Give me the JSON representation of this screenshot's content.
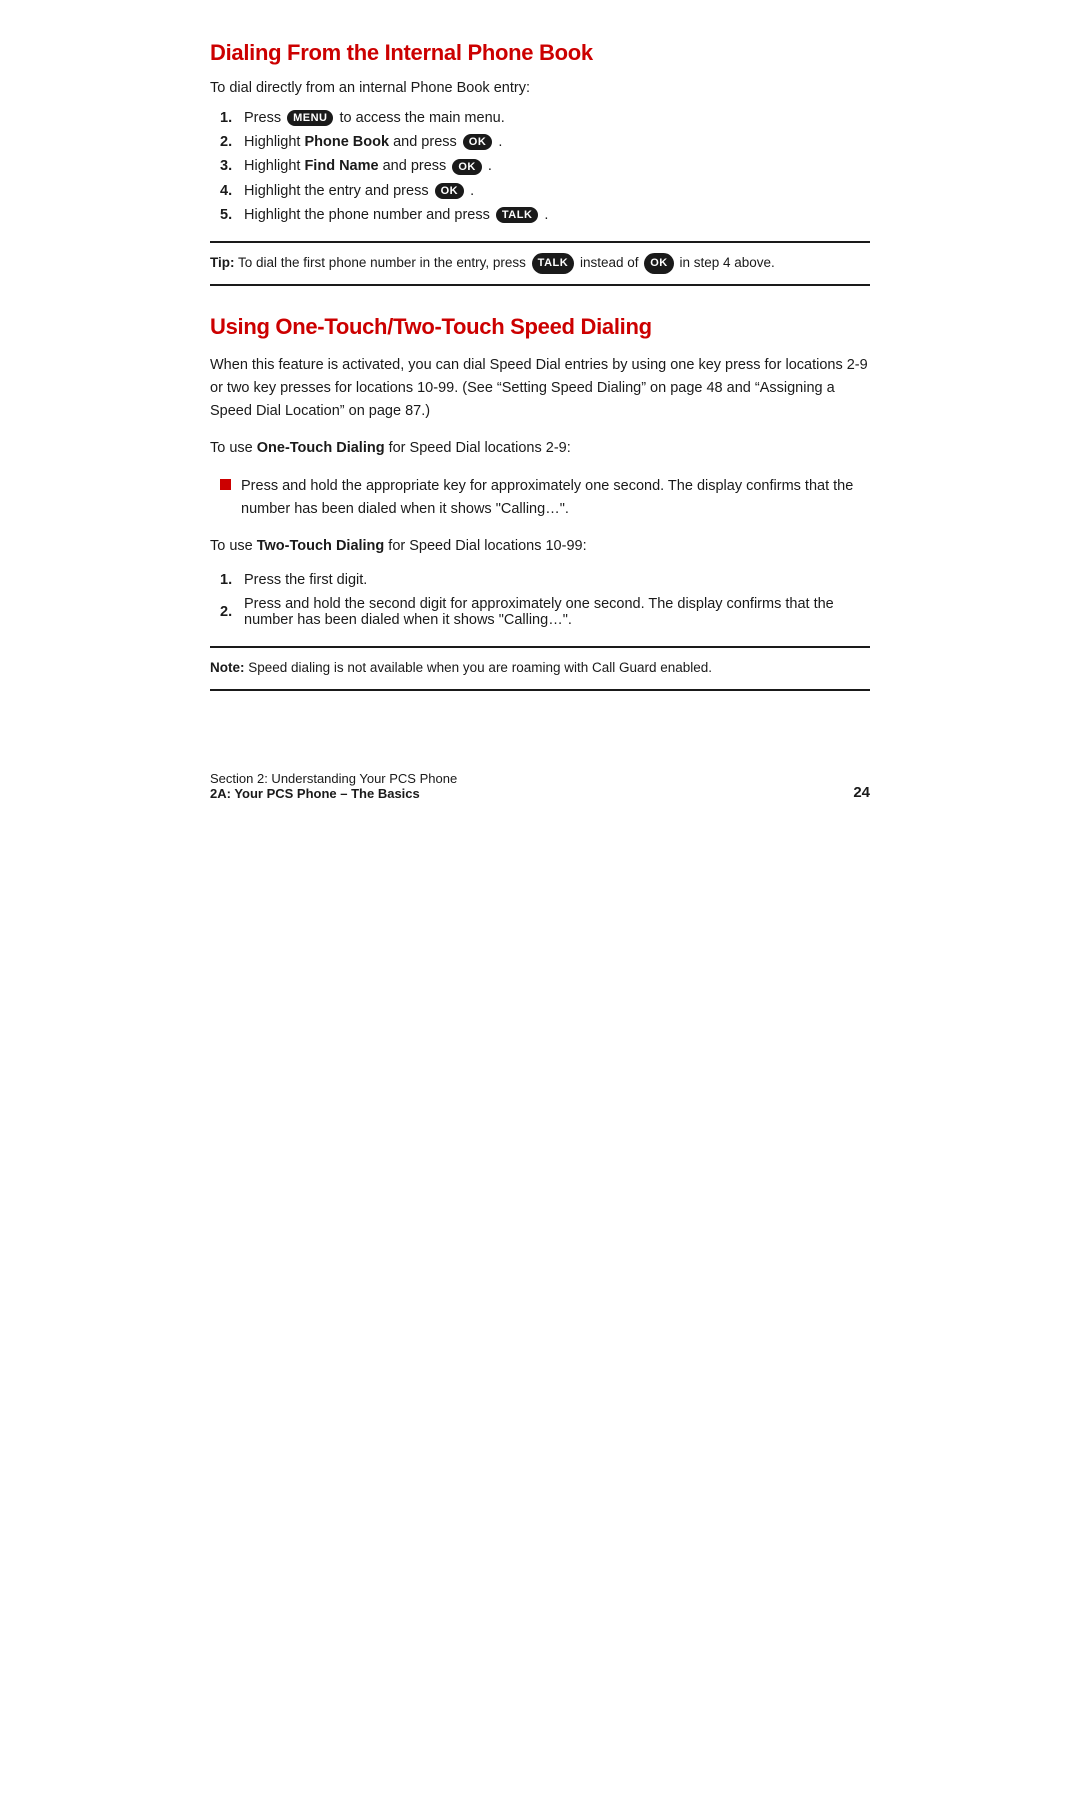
{
  "page": {
    "section1": {
      "title": "Dialing From the Internal Phone Book",
      "intro": "To dial directly from an internal Phone Book entry:",
      "steps": [
        {
          "num": "1.",
          "text_before": "Press ",
          "badge": "MENU",
          "text_after": " to access the main menu.",
          "badge_type": "round"
        },
        {
          "num": "2.",
          "text_before": "Highlight ",
          "bold": "Phone Book",
          "text_mid": " and press ",
          "badge": "OK",
          "text_after": ".",
          "badge_type": "round"
        },
        {
          "num": "3.",
          "text_before": "Highlight ",
          "bold": "Find Name",
          "text_mid": " and press ",
          "badge": "OK",
          "text_after": ".",
          "badge_type": "round"
        },
        {
          "num": "4.",
          "text_before": "Highlight the entry and press ",
          "badge": "OK",
          "text_after": ".",
          "badge_type": "round"
        },
        {
          "num": "5.",
          "text_before": "Highlight the phone number and press ",
          "badge": "TALK",
          "text_after": ".",
          "badge_type": "round"
        }
      ],
      "tip": {
        "label": "Tip:",
        "text_before": " To dial the first phone number in the entry, press ",
        "badge1": "TALK",
        "text_mid": " instead of ",
        "badge2": "OK",
        "text_after": " in step 4 above."
      }
    },
    "section2": {
      "title": "Using One-Touch/Two-Touch Speed Dialing",
      "intro": "When this feature is activated, you can dial Speed Dial entries by using one key press for locations 2-9 or two key presses for locations 10-99. (See “Setting Speed Dialing” on page 48 and “Assigning a Speed Dial Location” on page 87.)",
      "one_touch_intro_before": "To use ",
      "one_touch_bold": "One-Touch Dialing",
      "one_touch_intro_after": " for Speed Dial locations 2-9:",
      "one_touch_bullets": [
        "Press and hold the appropriate key for approximately one second. The display confirms that the number has been dialed when it shows “Calling…”."
      ],
      "two_touch_intro_before": "To use ",
      "two_touch_bold": "Two-Touch Dialing",
      "two_touch_intro_after": " for Speed Dial locations 10-99:",
      "two_touch_steps": [
        {
          "num": "1.",
          "text": "Press the first digit."
        },
        {
          "num": "2.",
          "text": "Press and hold the second digit for approximately one second. The display confirms that the number has been dialed when it shows “Calling…”."
        }
      ],
      "note": {
        "label": "Note:",
        "text": " Speed dialing is not available when you are roaming with Call Guard enabled."
      }
    },
    "footer": {
      "section_label": "Section 2: Understanding Your PCS Phone",
      "chapter_label": "2A: Your PCS Phone – The Basics",
      "page_number": "24"
    }
  }
}
